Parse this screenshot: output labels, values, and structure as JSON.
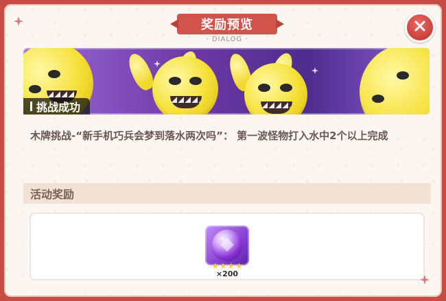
{
  "dialog": {
    "title": "奖励预览",
    "subtitle": "· DIALOG ·",
    "close_icon": "close-icon"
  },
  "banner": {
    "label": "挑战成功",
    "art": "yellow-bunny-mascots"
  },
  "description": "木牌挑战-“新手机巧兵会梦到落水两次吗”： 第一波怪物打入水中2个以上完成",
  "rewards_section": {
    "header": "活动奖励",
    "items": [
      {
        "icon": "purple-gem-orb-icon",
        "stars": 4,
        "quantity": "×200"
      }
    ]
  },
  "colors": {
    "border": "#c94b45",
    "title_ribbon": "#d2534c",
    "panel_bg": "#fbf6f1",
    "section_header_bg": "#f2e2d6"
  }
}
